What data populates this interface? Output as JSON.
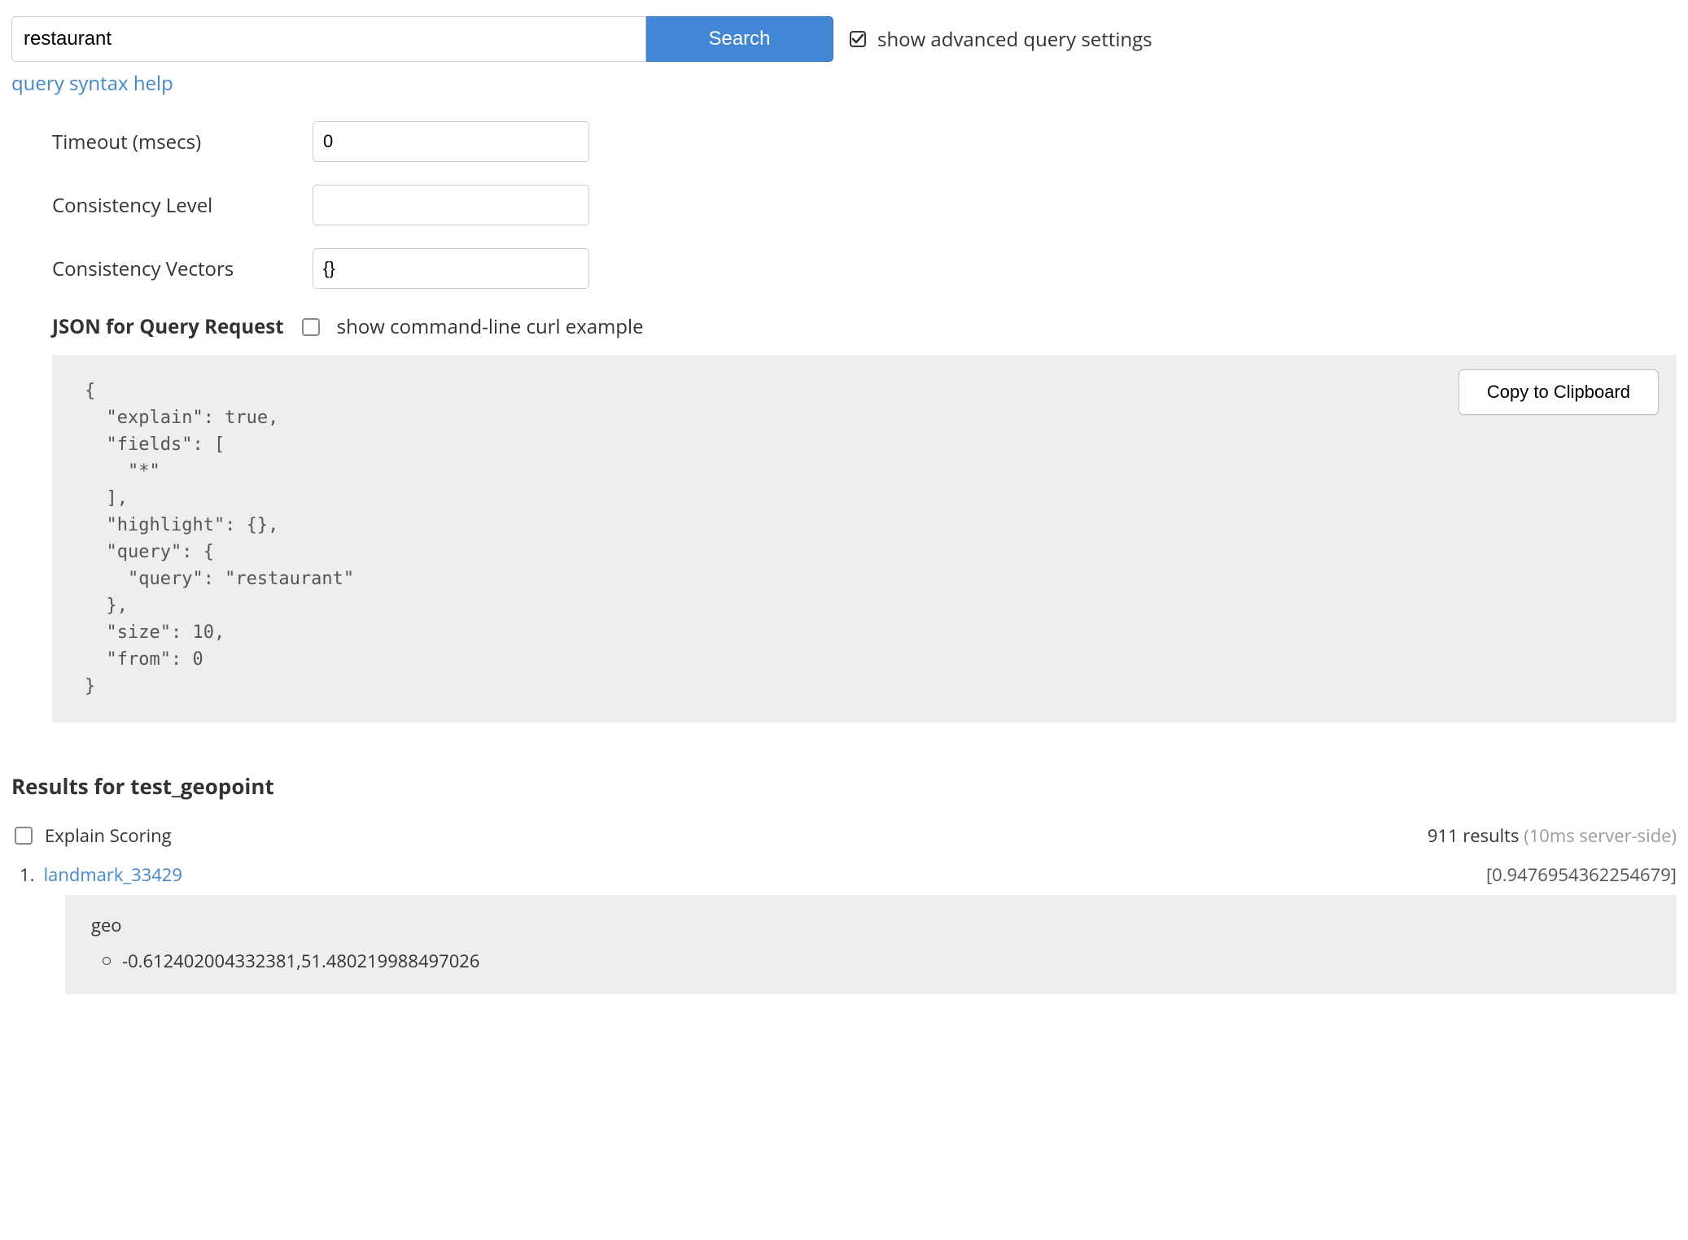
{
  "search": {
    "value": "restaurant",
    "button_label": "Search",
    "help_link": "query syntax help"
  },
  "adv_toggle": {
    "label": "show advanced query settings",
    "checked": true
  },
  "advanced": {
    "timeout": {
      "label": "Timeout (msecs)",
      "value": "0"
    },
    "consistency_level": {
      "label": "Consistency Level",
      "value": ""
    },
    "consistency_vectors": {
      "label": "Consistency Vectors",
      "value": "{}"
    }
  },
  "json_section": {
    "title": "JSON for Query Request",
    "curl_checkbox_label": "show command-line curl example",
    "curl_checked": false,
    "copy_button": "Copy to Clipboard",
    "body": "{\n  \"explain\": true,\n  \"fields\": [\n    \"*\"\n  ],\n  \"highlight\": {},\n  \"query\": {\n    \"query\": \"restaurant\"\n  },\n  \"size\": 10,\n  \"from\": 0\n}"
  },
  "results": {
    "heading_prefix": "Results for ",
    "index_name": "test_geopoint",
    "explain_label": "Explain Scoring",
    "explain_checked": false,
    "count_text": "911 results",
    "timing_text": "(10ms server-side)",
    "items": [
      {
        "idx": "1.",
        "id": "landmark_33429",
        "score": "[0.9476954362254679]",
        "fields": [
          {
            "name": "geo",
            "value": "-0.612402004332381,51.480219988497026"
          }
        ]
      }
    ]
  }
}
